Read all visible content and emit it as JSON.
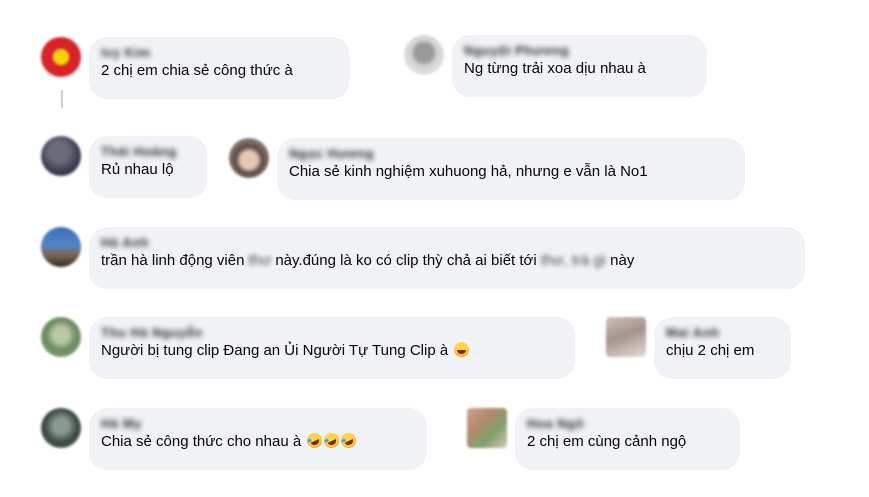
{
  "comments": [
    {
      "name": "Ivy Kim",
      "text": "2 chị em chia sẻ công thức à"
    },
    {
      "name": "Nguyệt Phương",
      "text": "Ng từng trải xoa dịu nhau à"
    },
    {
      "name": "Thái Hoàng",
      "text": "Rủ nhau lộ"
    },
    {
      "name": "Ngọc Hương",
      "text": "Chia sẻ kinh nghiệm xuhuong hả, nhưng e vẫn là No1"
    },
    {
      "name": "Hà Anh",
      "text_before": "trần hà linh động viên",
      "text_hidden1": "thư",
      "text_mid": "này.đúng là ko có clip thỳ chả ai biết tới",
      "text_hidden2": "thư, trà gì",
      "text_after": "này"
    },
    {
      "name": "Thu Hà Nguyễn",
      "text": "Người bị tung clip Đang an Ủi Người Tự Tung Clip à"
    },
    {
      "name": "Mai Anh",
      "text": "chịu 2 chị em"
    },
    {
      "name": "Hà My",
      "text": "Chia sẻ công thức cho nhau à"
    },
    {
      "name": "Hoa Ngô",
      "text": "2 chị em cùng cảnh ngộ"
    }
  ]
}
